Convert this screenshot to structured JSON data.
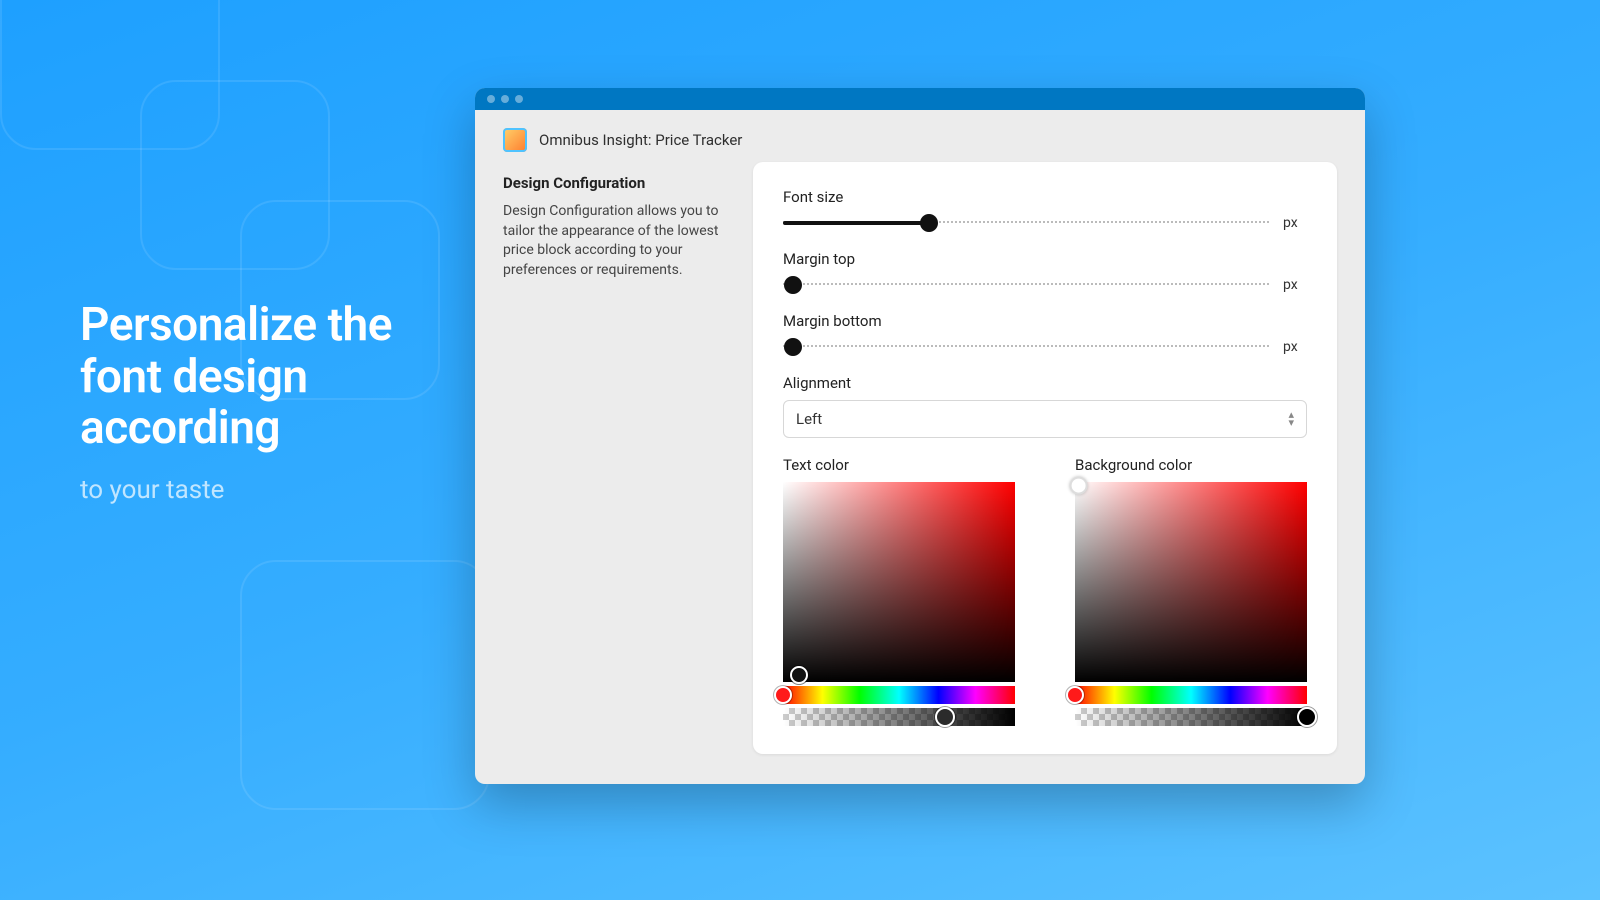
{
  "promo": {
    "headline": "Personalize the font design according",
    "subline": "to your taste"
  },
  "app": {
    "title": "Omnibus Insight: Price Tracker"
  },
  "sidebar": {
    "heading": "Design Configuration",
    "description": "Design Configuration allows you to tailor the appearance of the lowest price block according to your preferences or requirements."
  },
  "panel": {
    "font_size": {
      "label": "Font size",
      "unit": "px",
      "fill_percent": 30
    },
    "margin_top": {
      "label": "Margin top",
      "unit": "px",
      "fill_percent": 0
    },
    "margin_bottom": {
      "label": "Margin bottom",
      "unit": "px",
      "fill_percent": 0
    },
    "alignment": {
      "label": "Alignment",
      "value": "Left"
    },
    "text_color": {
      "label": "Text color",
      "hue_percent": 0,
      "alpha_percent": 70,
      "sv_x_percent": 3,
      "sv_y_percent": 92,
      "swatch": "#111111"
    },
    "background_color": {
      "label": "Background color",
      "hue_percent": 0,
      "alpha_percent": 100,
      "sv_x_percent": 0,
      "sv_y_percent": 0,
      "swatch": "#ffffff"
    }
  }
}
